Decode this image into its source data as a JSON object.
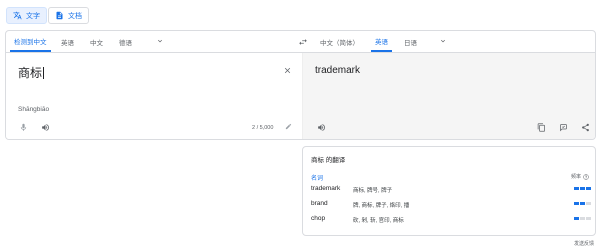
{
  "modes": [
    {
      "label": "文字",
      "icon": "translate-icon",
      "active": true
    },
    {
      "label": "文档",
      "icon": "document-icon",
      "active": false
    }
  ],
  "source_langs": [
    "检测到中文",
    "英语",
    "中文",
    "德语"
  ],
  "target_langs": [
    "中文（简体）",
    "英语",
    "日语"
  ],
  "source": {
    "text": "商标",
    "romanization": "Shāngbiāo",
    "char_count": "2 / 5,000"
  },
  "target": {
    "text": "trademark"
  },
  "dictionary": {
    "title": "商标 的翻译",
    "pos": "名词",
    "frequency_label": "频率",
    "entries": [
      {
        "word": "trademark",
        "synonyms": "商标, 牌号, 牌子",
        "frequency": 3
      },
      {
        "word": "brand",
        "synonyms": "牌, 商标, 牌子, 烙印, 播",
        "frequency": 2
      },
      {
        "word": "chop",
        "synonyms": "砍, 剁, 斩, 官印, 商标",
        "frequency": 1
      }
    ]
  },
  "feedback": "发送反馈",
  "colors": {
    "accent": "#1a73e8",
    "border": "#dadce0",
    "target_bg": "#f5f5f5"
  }
}
